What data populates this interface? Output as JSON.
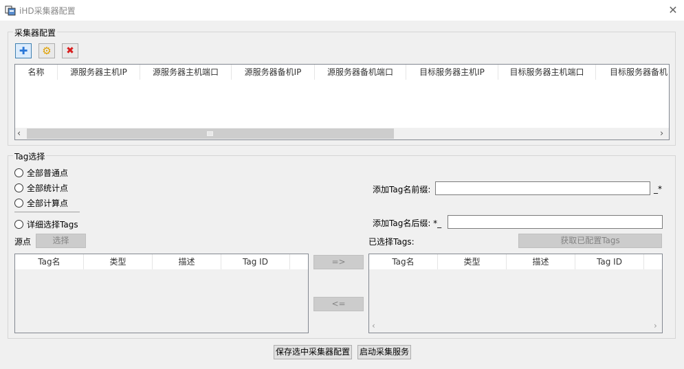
{
  "window": {
    "title": "iHD采集器配置",
    "close_glyph": "✕"
  },
  "collector_group": {
    "legend": "采集器配置",
    "toolbar": [
      {
        "name": "add-icon",
        "glyph": "✚",
        "color": "#2b78d8"
      },
      {
        "name": "gear-icon",
        "glyph": "⚙",
        "color": "#e0a000"
      },
      {
        "name": "delete-icon",
        "glyph": "✖",
        "color": "#d81e1e"
      }
    ],
    "columns": [
      "名称",
      "源服务器主机IP",
      "源服务器主机端口",
      "源服务器备机IP",
      "源服务器备机端口",
      "目标服务器主机IP",
      "目标服务器主机端口",
      "目标服务器备机"
    ]
  },
  "tag_group": {
    "legend": "Tag选择",
    "radios": [
      "全部普通点",
      "全部统计点",
      "全部计算点"
    ],
    "detail_radio": "详细选择Tags",
    "source_label": "源点",
    "select_button": "选择",
    "source_columns": [
      "Tag名",
      "类型",
      "描述",
      "Tag ID"
    ],
    "move_right": "=>",
    "move_left": "<=",
    "prefix_label": "添加Tag名前缀:",
    "prefix_value": "",
    "prefix_suffix": "_*",
    "suffix_label": "添加Tag名后缀: *_",
    "suffix_value": "",
    "selected_label": "已选择Tags:",
    "fetch_button": "获取已配置Tags",
    "selected_columns": [
      "Tag名",
      "类型",
      "描述",
      "Tag ID"
    ]
  },
  "footer": {
    "save_button": "保存选中采集器配置",
    "start_button": "启动采集服务"
  }
}
